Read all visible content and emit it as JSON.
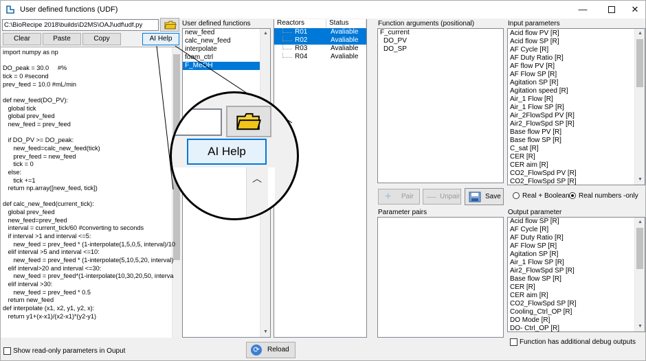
{
  "window": {
    "title": "User defined functions (UDF)",
    "minimize": "—",
    "close": "✕"
  },
  "left": {
    "path": "C:\\BioRecipe 2018\\builds\\D2MS\\OAJ\\udf\\udf.py",
    "buttons": {
      "clear": "Clear",
      "paste": "Paste",
      "copy": "Copy",
      "ai_help": "AI Help"
    },
    "code": "import numpy as np\n\nDO_peak = 30.0     #%\ntick = 0 #second\nprev_feed = 10.0 #mL/min\n\ndef new_feed(DO_PV):\n   global tick\n   global prev_feed\n   new_feed = prev_feed\n\n   if DO_PV >= DO_peak:\n      new_feed=calc_new_feed(tick)\n      prev_feed = new_feed\n      tick = 0\n   else:\n      tick +=1\n   return np.array([new_feed, tick])\n\ndef calc_new_feed(current_tick):\n   global prev_feed\n   new_feed=prev_feed\n   interval = current_tick/60 #converting to seconds\n   if interval >1 and interval <=5:\n      new_feed = prev_feed * (1-interpolate(1,5,0,5, interval)/10\n   elif interval >5 and interval <=10:\n      new_feed = prev_feed * (1-interpolate(5,10,5,20, interval)\n   elif interval>20 and interval <=30:\n      new_feed = prev_feed*(1-interpolate(10,30,20,50, interva\n   elif interval >30:\n      new_feed = prev_feed * 0.5\n   return new_feed\ndef interpolate (x1, x2, y1, y2, x):\n   return y1+(x-x1)/(x2-x1)*(y2-y1)",
    "show_readonly": "Show read-only parameters in Ouput"
  },
  "udf": {
    "header": "User defined functions",
    "items": [
      "new_feed",
      "calc_new_feed",
      "interpolate",
      "foam_ctrl",
      "F_MeOH"
    ],
    "selected": "F_MeOH",
    "reload": "Reload"
  },
  "reactors": {
    "col_reactors": "Reactors",
    "col_status": "Status",
    "rows": [
      {
        "name": "R01",
        "status": "Avaliable",
        "selected": true
      },
      {
        "name": "R02",
        "status": "Avaliable",
        "selected": true
      },
      {
        "name": "R03",
        "status": "Avaliable",
        "selected": false
      },
      {
        "name": "R04",
        "status": "Avaliable",
        "selected": false
      }
    ]
  },
  "func_args": {
    "header": "Function arguments (positional)",
    "items": [
      "F_current",
      "DO_PV",
      "DO_SP"
    ]
  },
  "input_params": {
    "header": "Input parameters",
    "items": [
      "Acid flow PV [R]",
      "Acid flow SP [R]",
      "AF Cycle [R]",
      "AF Duty Ratio [R]",
      "AF flow PV [R]",
      "AF Flow SP [R]",
      "Agitation SP [R]",
      "Agitation speed [R]",
      "Air_1 Flow [R]",
      "Air_1 Flow SP [R]",
      "Air_2FlowSpd PV [R]",
      "Air2_FlowSpd SP [R]",
      "Base flow PV [R]",
      "Base flow SP [R]",
      "C_sat [R]",
      "CER [R]",
      "CER aim [R]",
      "CO2_FlowSpd PV [R]",
      "CO2_FlowSpd SP [R]"
    ]
  },
  "actions": {
    "pair": "Pair",
    "unpair": "Unpair",
    "save": "Save",
    "radio_bool": "Real + Boolean",
    "radio_real": "Real numbers -only"
  },
  "pairs": {
    "header": "Parameter pairs"
  },
  "output_params": {
    "header": "Output parameter",
    "items": [
      "Acid flow SP [R]",
      "AF Cycle [R]",
      "AF Duty Ratio [R]",
      "AF Flow SP [R]",
      "Agitation SP [R]",
      "Air_1 Flow SP [R]",
      "Air2_FlowSpd SP [R]",
      "Base flow SP [R]",
      "CER [R]",
      "CER aim [R]",
      "CO2_FlowSpd SP [R]",
      "Cooling_Ctrl_OP [R]",
      "DO Mode [R]",
      "DO-  Ctrl_OP [R]"
    ],
    "debug": "Function has additional debug outputs"
  },
  "zoom": {
    "button": "AI Help"
  },
  "colors": {
    "selection": "#0078d7",
    "window_bg": "#f0f0f0"
  }
}
